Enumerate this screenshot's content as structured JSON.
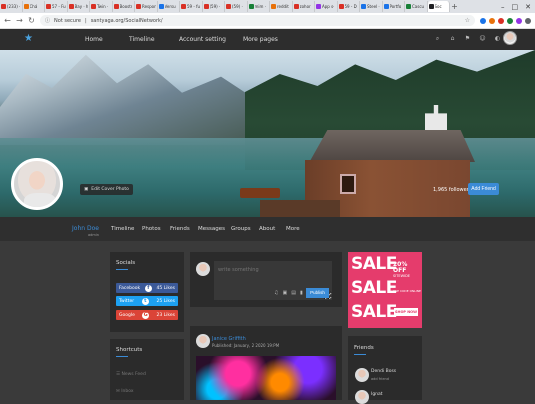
{
  "browser": {
    "tabs": [
      {
        "label": "(233) ·",
        "color": "#d93025"
      },
      {
        "label": "Chá",
        "color": "#e8710a"
      },
      {
        "label": "57 - Fu",
        "color": "#d93025"
      },
      {
        "label": "Bay · ha",
        "color": "#d93025"
      },
      {
        "label": "Twin ·",
        "color": "#d93025"
      },
      {
        "label": "Boostr",
        "color": "#d93025"
      },
      {
        "label": "Respon",
        "color": "#d93025"
      },
      {
        "label": "Versu",
        "color": "#1a73e8"
      },
      {
        "label": "59 - fu",
        "color": "#d93025"
      },
      {
        "label": "(59) ·",
        "color": "#d93025"
      },
      {
        "label": "(59) ·",
        "color": "#d93025"
      },
      {
        "label": "mim ·",
        "color": "#188038"
      },
      {
        "label": "reddit",
        "color": "#e8710a"
      },
      {
        "label": "zohor",
        "color": "#d93025"
      },
      {
        "label": "App s·",
        "color": "#9334e6"
      },
      {
        "label": "59 - D",
        "color": "#d93025"
      },
      {
        "label": "Steel ·",
        "color": "#1a73e8"
      },
      {
        "label": "Portfo",
        "color": "#1a73e8"
      },
      {
        "label": "Cascu",
        "color": "#188038"
      },
      {
        "label": "Soc",
        "color": "#202124"
      }
    ],
    "new_tab": "+",
    "window_controls": [
      "–",
      "□",
      "✕"
    ],
    "url_prefix": "Not secure",
    "url": "santyaga.org/SocialNetwork/",
    "extension_colors": [
      "#1a73e8",
      "#e8710a",
      "#d93025",
      "#188038",
      "#9334e6",
      "#5f6368"
    ]
  },
  "nav": {
    "logo_icon": "★",
    "links": [
      "Home",
      "Timeline",
      "Account setting",
      "More pages"
    ],
    "icons": [
      "⌕",
      "⌂",
      "⚑",
      "☺",
      "◐"
    ]
  },
  "cover": {
    "edit_label": "Edit Cover Photo",
    "followers": "1,965 followers",
    "add_friend": "Add Friend"
  },
  "profile": {
    "name": "John Doe",
    "username": "admin",
    "tabs": [
      "Timeline",
      "Photos",
      "Friends",
      "Messages",
      "Groups",
      "About",
      "More"
    ]
  },
  "socials": {
    "title": "Socials",
    "items": [
      {
        "label": "Facebook",
        "icon": "f",
        "count": "45 Likes",
        "color": "#3b5998"
      },
      {
        "label": "Twitter",
        "icon": "t",
        "count": "25 Likes",
        "color": "#1da1f2"
      },
      {
        "label": "Google",
        "icon": "G",
        "count": "23 Likes",
        "color": "#db4437"
      }
    ]
  },
  "shortcuts": {
    "title": "Shortcuts",
    "items": [
      "News Feed",
      "Inbox"
    ]
  },
  "composer": {
    "placeholder": "write something",
    "publish": "Publish",
    "tools": [
      "♫",
      "▣",
      "▤",
      "▮",
      "⚙"
    ]
  },
  "post": {
    "author": "Janice Griffith",
    "date": "Published: January, 2 2020 19:PM"
  },
  "ad": {
    "words": [
      "SALE",
      "SALE",
      "SALE"
    ],
    "discount": "20% OFF",
    "sitewide": "SITEWIDE",
    "note": "USE CODE ONLINE",
    "shop": "SHOP NOW"
  },
  "friends": {
    "title": "Friends",
    "items": [
      {
        "name": "Dendi Boss",
        "sub": "add friend"
      },
      {
        "name": "Ignat",
        "sub": ""
      }
    ]
  }
}
